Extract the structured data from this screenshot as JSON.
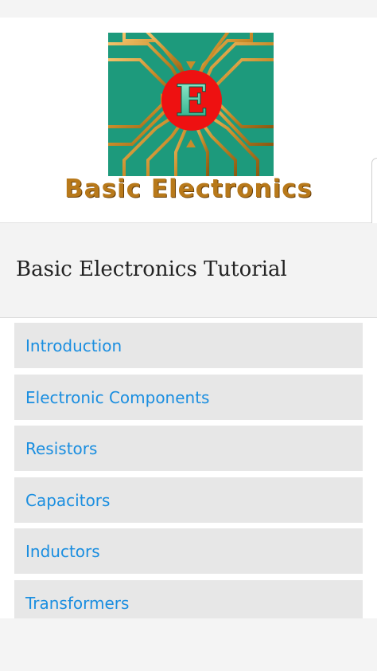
{
  "header": {
    "logo_letter": "E",
    "logo_text": "Basic Electronics"
  },
  "page": {
    "title": "Basic Electronics Tutorial"
  },
  "menu": {
    "items": [
      {
        "label": "Introduction"
      },
      {
        "label": "Electronic Components"
      },
      {
        "label": "Resistors"
      },
      {
        "label": "Capacitors"
      },
      {
        "label": "Inductors"
      },
      {
        "label": "Transformers"
      }
    ]
  },
  "colors": {
    "logo_background": "#1d9a7c",
    "logo_circle": "#ee1111",
    "logo_traces": "#c98c2a",
    "link": "#1a8ee0",
    "menu_item_bg": "#e7e7e7"
  }
}
